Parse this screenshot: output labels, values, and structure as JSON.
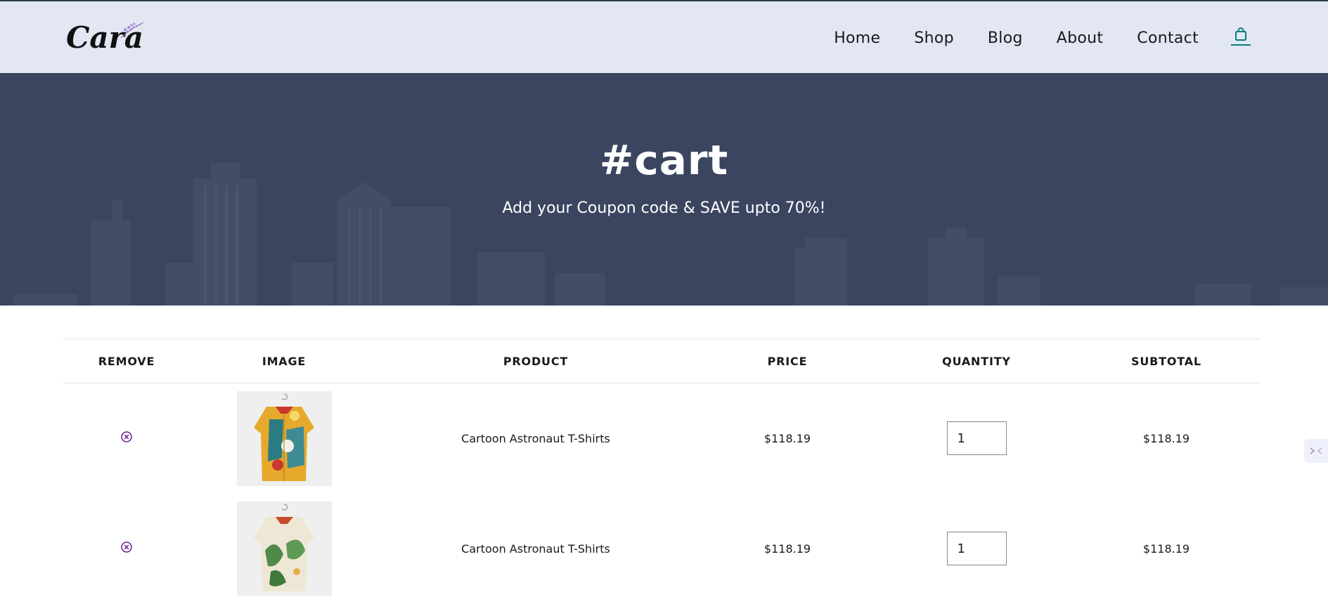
{
  "brand": {
    "logo_text": "Cara",
    "accent_color": "#088178"
  },
  "nav": {
    "items": [
      {
        "label": "Home"
      },
      {
        "label": "Shop"
      },
      {
        "label": "Blog"
      },
      {
        "label": "About"
      },
      {
        "label": "Contact"
      }
    ],
    "cart_icon": "shopping-bag-icon"
  },
  "hero": {
    "title": "#cart",
    "subtitle": "Add your Coupon code & SAVE upto 70%!"
  },
  "cart": {
    "headers": [
      "REMOVE",
      "IMAGE",
      "PRODUCT",
      "PRICE",
      "QUANTITY",
      "SUBTOTAL"
    ],
    "rows": [
      {
        "remove_icon": "remove-circle-icon",
        "image": "astronaut-shirt-yellow",
        "product": "Cartoon Astronaut T-Shirts",
        "price": "$118.19",
        "quantity": "1",
        "subtotal": "$118.19"
      },
      {
        "remove_icon": "remove-circle-icon",
        "image": "floral-shirt-green",
        "product": "Cartoon Astronaut T-Shirts",
        "price": "$118.19",
        "quantity": "1",
        "subtotal": "$118.19"
      }
    ]
  },
  "colors": {
    "header_bg": "#e3e6f3",
    "hero_bg": "#3b4560",
    "remove_icon": "#6a2a9c"
  }
}
